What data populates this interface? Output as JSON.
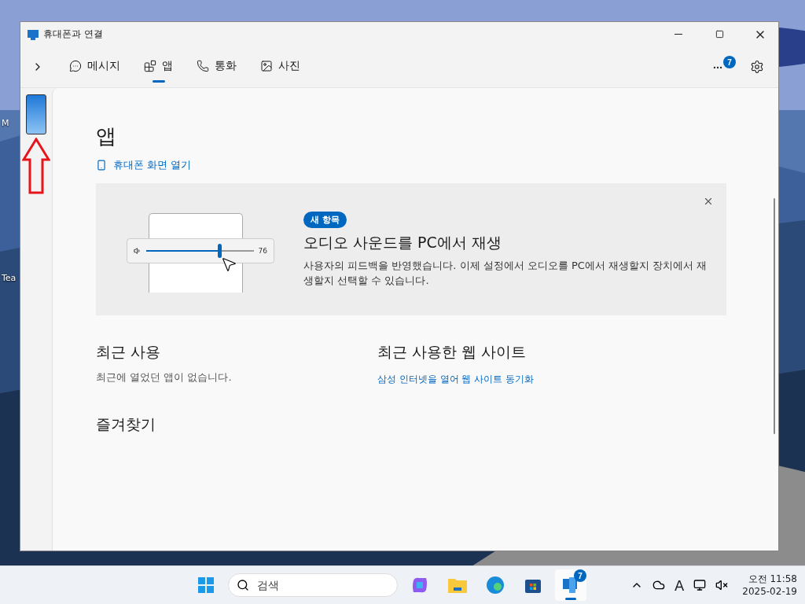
{
  "desktop": {
    "icons": [
      {
        "label": "M"
      },
      {
        "label": "Tea"
      }
    ]
  },
  "window": {
    "title": "휴대폰과 연결"
  },
  "nav": {
    "tabs": [
      {
        "kind": "messages",
        "label": "메시지",
        "selected": false
      },
      {
        "kind": "apps",
        "label": "앱",
        "selected": true
      },
      {
        "kind": "calls",
        "label": "통화",
        "selected": false
      },
      {
        "kind": "photos",
        "label": "사진",
        "selected": false
      }
    ],
    "badge": "7"
  },
  "page": {
    "title": "앱",
    "open_link": "휴대폰 화면 열기",
    "banner": {
      "tag": "새 항목",
      "title": "오디오 사운드를 PC에서 재생",
      "body": "사용자의 피드백을 반영했습니다. 이제 설정에서 오디오를 PC에서 재생할지 장치에서 재생할지 선택할 수 있습니다.",
      "slider": {
        "level": 0.68,
        "reading": "76"
      }
    },
    "recent": {
      "title": "최근 사용",
      "empty": "최근에 열었던 앱이 없습니다."
    },
    "websites": {
      "title": "최근 사용한 웹 사이트",
      "link": "삼성 인터넷을 열어 웹 사이트 동기화"
    },
    "favorites": {
      "title": "즐겨찾기"
    }
  },
  "taskbar": {
    "search": {
      "placeholder": "검색"
    },
    "apps": [
      {
        "kind": "copilot",
        "selected": false
      },
      {
        "kind": "folder",
        "selected": false
      },
      {
        "kind": "edge",
        "selected": false
      },
      {
        "kind": "store",
        "selected": false
      },
      {
        "kind": "phone",
        "selected": true,
        "badge": "7"
      }
    ],
    "ime": "A",
    "clock": {
      "time": "오전 11:58",
      "date": "2025-02-19"
    }
  }
}
